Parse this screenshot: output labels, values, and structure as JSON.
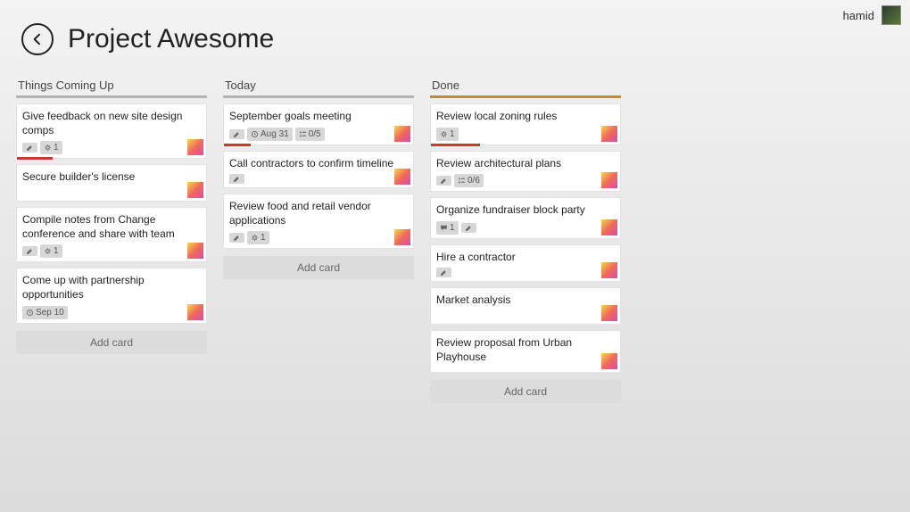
{
  "user": {
    "name": "hamid"
  },
  "board": {
    "title": "Project Awesome"
  },
  "lists": [
    {
      "title": "Things Coming Up",
      "addLabel": "Add card",
      "cards": [
        {
          "title": "Give feedback on new site design comps",
          "badges": [
            {
              "icon": "pencil"
            },
            {
              "icon": "gear",
              "text": "1"
            }
          ],
          "member": true,
          "stripeWidth": 40
        },
        {
          "title": "Secure builder's license",
          "badges": [],
          "member": true
        },
        {
          "title": "Compile notes from Change conference and share with team",
          "badges": [
            {
              "icon": "pencil"
            },
            {
              "icon": "gear",
              "text": "1"
            }
          ],
          "member": true
        },
        {
          "title": "Come up with partnership opportunities",
          "badges": [
            {
              "icon": "clock",
              "text": "Sep 10"
            }
          ],
          "member": true
        }
      ]
    },
    {
      "title": "Today",
      "addLabel": "Add card",
      "cards": [
        {
          "title": "September goals meeting",
          "badges": [
            {
              "icon": "pencil"
            },
            {
              "icon": "clock",
              "text": "Aug 31"
            },
            {
              "icon": "checklist",
              "text": "0/5"
            }
          ],
          "member": true,
          "stripeWidth": 30
        },
        {
          "title": "Call contractors to confirm timeline",
          "badges": [
            {
              "icon": "pencil"
            }
          ],
          "member": true
        },
        {
          "title": "Review food and retail vendor applications",
          "badges": [
            {
              "icon": "pencil"
            },
            {
              "icon": "gear",
              "text": "1"
            }
          ],
          "member": true
        }
      ]
    },
    {
      "title": "Done",
      "addLabel": "Add card",
      "done": true,
      "cards": [
        {
          "title": "Review local zoning rules",
          "badges": [
            {
              "icon": "gear",
              "text": "1"
            }
          ],
          "member": true,
          "stripeWidth": 55
        },
        {
          "title": "Review architectural plans",
          "badges": [
            {
              "icon": "pencil"
            },
            {
              "icon": "checklist",
              "text": "0/6"
            }
          ],
          "member": true
        },
        {
          "title": "Organize fundraiser block party",
          "badges": [
            {
              "icon": "comment",
              "text": "1"
            },
            {
              "icon": "pencil"
            }
          ],
          "member": true
        },
        {
          "title": "Hire a contractor",
          "badges": [
            {
              "icon": "pencil"
            }
          ],
          "member": true
        },
        {
          "title": "Market analysis",
          "badges": [],
          "member": true
        },
        {
          "title": "Review proposal from Urban Playhouse",
          "badges": [],
          "member": true
        }
      ]
    }
  ]
}
